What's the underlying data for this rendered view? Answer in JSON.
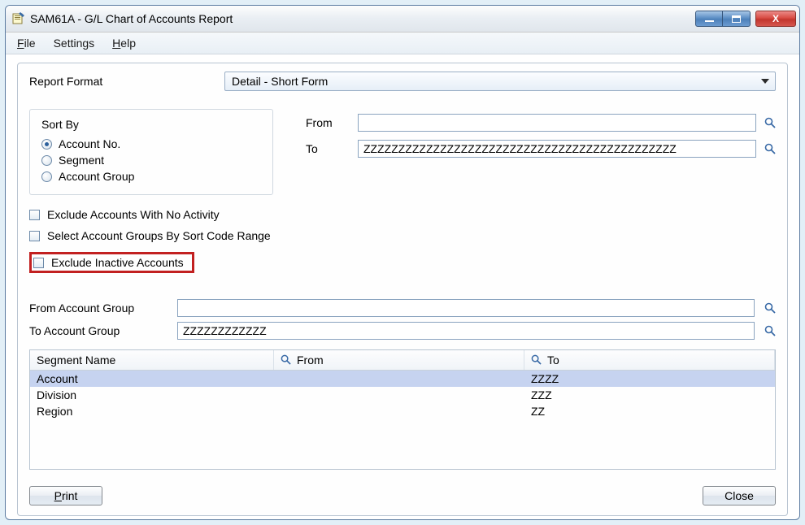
{
  "window": {
    "title": "SAM61A - G/L Chart of Accounts Report"
  },
  "menu": {
    "file": "File",
    "file_u": "F",
    "settings": "Settings",
    "help": "Help",
    "help_u": "H"
  },
  "labels": {
    "report_format": "Report Format",
    "sort_by": "Sort By",
    "from": "From",
    "to": "To",
    "from_account_group": "From Account Group",
    "to_account_group": "To Account Group"
  },
  "report_format_value": "Detail - Short Form",
  "sort_by": {
    "account_no": "Account No.",
    "segment": "Segment",
    "account_group": "Account Group",
    "selected": "account_no"
  },
  "range": {
    "from_value": "",
    "to_value": "ZZZZZZZZZZZZZZZZZZZZZZZZZZZZZZZZZZZZZZZZZZZZZ"
  },
  "checkboxes": {
    "exclude_no_activity": "Exclude Accounts With No Activity",
    "select_by_sort_code": "Select Account Groups By Sort Code Range",
    "exclude_inactive": "Exclude Inactive Accounts"
  },
  "account_group": {
    "from_value": "",
    "to_value": "ZZZZZZZZZZZZ"
  },
  "table": {
    "headers": {
      "segment": "Segment Name",
      "from": "From",
      "to": "To"
    },
    "rows": [
      {
        "segment": "Account",
        "from": "",
        "to": "ZZZZ",
        "selected": true
      },
      {
        "segment": "Division",
        "from": "",
        "to": "ZZZ",
        "selected": false
      },
      {
        "segment": "Region",
        "from": "",
        "to": "ZZ",
        "selected": false
      }
    ]
  },
  "buttons": {
    "print": "Print",
    "print_u": "P",
    "close": "Close"
  }
}
